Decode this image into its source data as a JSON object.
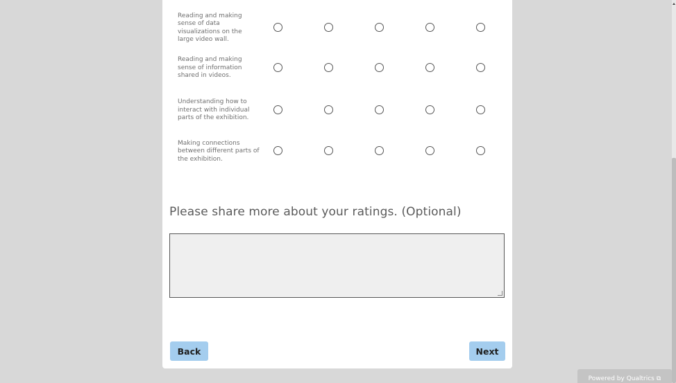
{
  "matrix": {
    "rows": [
      {
        "label": "Reading and making sense of data visualizations on the large video wall."
      },
      {
        "label": "Reading and making sense of information shared in videos."
      },
      {
        "label": "Understanding how to interact with individual parts of the exhibition."
      },
      {
        "label": "Making connections between different parts of the exhibition."
      }
    ]
  },
  "question": {
    "title": "Please share more about your ratings. (Optional)",
    "value": ""
  },
  "nav": {
    "back_label": "Back",
    "next_label": "Next"
  },
  "footer": {
    "powered_label": "Powered by Qualtrics",
    "icon": "external-link-icon"
  },
  "colors": {
    "button": "#a4cdee",
    "background": "#d8d8d8",
    "card": "#ffffff"
  }
}
